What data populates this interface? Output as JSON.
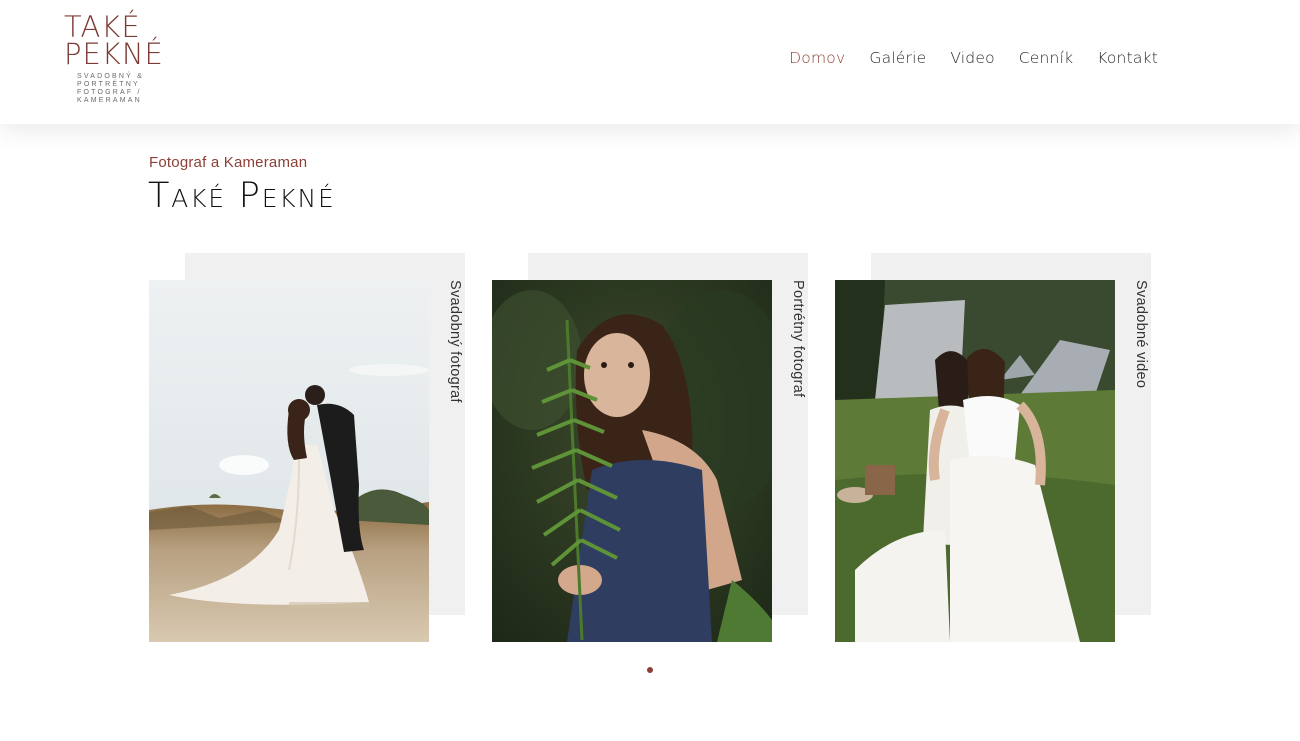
{
  "brand": {
    "logo_line1": "TAKÉ",
    "logo_line2": "PEKNÉ",
    "tagline": "SVADOBNÝ & PORTRÉTNY FOTOGRAF / KAMERAMAN"
  },
  "nav": {
    "items": [
      {
        "label": "Domov",
        "active": true
      },
      {
        "label": "Galérie",
        "active": false
      },
      {
        "label": "Video",
        "active": false
      },
      {
        "label": "Cenník",
        "active": false
      },
      {
        "label": "Kontakt",
        "active": false
      }
    ]
  },
  "hero": {
    "kicker": "Fotograf a Kameraman",
    "title": "Také Pekné"
  },
  "cards": [
    {
      "label": "Svadobný fotograf",
      "photo": "wedding-couple-photo"
    },
    {
      "label": "Portrétny fotograf",
      "photo": "girl-with-fern-portrait"
    },
    {
      "label": "Svadobné video",
      "photo": "brides-laughing-photo"
    }
  ],
  "carousel": {
    "total_dots": 1,
    "active_dot": 1
  },
  "colors": {
    "accent": "#8b3f36",
    "card_background": "#f0f0f0",
    "text": "#1e1e1e"
  }
}
